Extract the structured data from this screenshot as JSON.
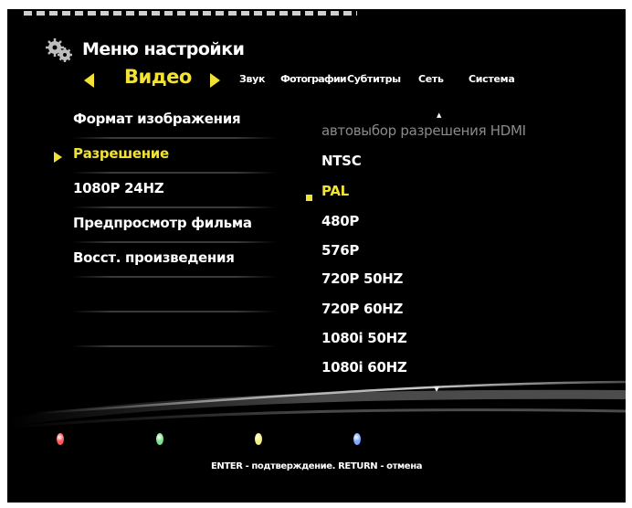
{
  "header": {
    "title": "Меню настройки"
  },
  "tabs": {
    "active": "Видео",
    "others": [
      "Звук",
      "Фотографии",
      "Субтитры",
      "Сеть",
      "Система"
    ]
  },
  "settings": [
    {
      "label": "Формат изображения"
    },
    {
      "label": "Разрешение",
      "selected": true
    },
    {
      "label": "1080P 24HZ"
    },
    {
      "label": "Предпросмотр фильма"
    },
    {
      "label": "Восст. произведения"
    }
  ],
  "options": [
    {
      "label": "автовыбор разрешения HDMI",
      "disabled": true
    },
    {
      "label": "NTSC"
    },
    {
      "label": "PAL",
      "selected": true
    },
    {
      "label": "480P"
    },
    {
      "label": "576P"
    },
    {
      "label": "720P 50HZ"
    },
    {
      "label": "720P 60HZ"
    },
    {
      "label": "1080i 50HZ"
    },
    {
      "label": "1080i 60HZ"
    }
  ],
  "color_buttons": [
    "#ff5a5a",
    "#7fe08a",
    "#f3ef7a",
    "#7fa8ff"
  ],
  "footer": {
    "hint": "ENTER - подтверждение. RETURN - отмена"
  },
  "icons": [
    "gear-icon",
    "arrow-left-icon",
    "arrow-right-icon",
    "scroll-up-icon",
    "scroll-down-icon"
  ]
}
